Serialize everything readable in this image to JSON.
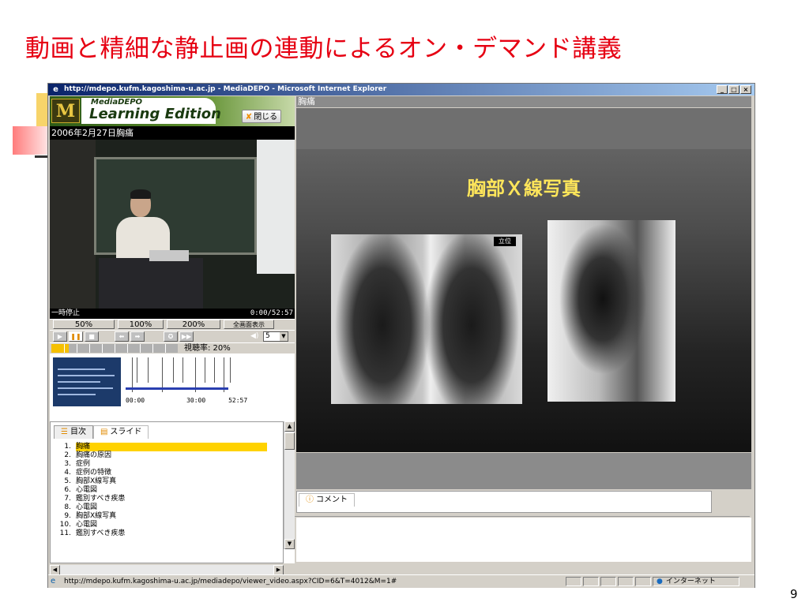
{
  "slide": {
    "title": "動画と精細な静止画の連動によるオン・デマンド講義",
    "page_number": "9"
  },
  "window": {
    "title": "http://mdepo.kufm.kagoshima-u.ac.jp - MediaDEPO - Microsoft Internet Explorer",
    "buttons": {
      "minimize": "_",
      "maximize": "□",
      "close": "×"
    }
  },
  "app": {
    "logo_small": "MediaDEPO",
    "logo_big": "Learning Edition",
    "logo_letter": "M",
    "close_button": "閉じる",
    "lecture_title": "2006年2月27日胸痛"
  },
  "player": {
    "status": "一時停止",
    "time": "0:00/52:57",
    "zoom_buttons": [
      "50%",
      "100%",
      "200%",
      "全画面表示"
    ],
    "volume_value": "5",
    "view_rate": "視聴率: 20%",
    "progress_fraction": 0.14,
    "timeline_labels": [
      "00:00",
      "30:00",
      "52:57"
    ]
  },
  "toc": {
    "tabs": [
      "目次",
      "スライド"
    ],
    "items": [
      {
        "num": "1.",
        "label": "胸痛"
      },
      {
        "num": "2.",
        "label": "胸痛の原因"
      },
      {
        "num": "3.",
        "label": "症例"
      },
      {
        "num": "4.",
        "label": "症例の特徴"
      },
      {
        "num": "5.",
        "label": "胸部X線写真"
      },
      {
        "num": "6.",
        "label": "心電図"
      },
      {
        "num": "7.",
        "label": "鑑別すべき疾患"
      },
      {
        "num": "8.",
        "label": "心電図"
      },
      {
        "num": "9.",
        "label": "胸部X線写真"
      },
      {
        "num": "10.",
        "label": "心電図"
      },
      {
        "num": "11.",
        "label": "鑑別すべき疾患"
      }
    ]
  },
  "slide_view": {
    "label": "胸痛",
    "heading": "胸部Ｘ線写真",
    "xray_tag": "立位"
  },
  "comment": {
    "tab_label": "コメント"
  },
  "statusbar": {
    "url": "http://mdepo.kufm.kagoshima-u.ac.jp/mediadepo/viewer_video.aspx?CID=6&T=4012&M=1#",
    "zone": "インターネット"
  },
  "colors": {
    "title_red": "#e60012",
    "highlight": "#ffd200",
    "slide_heading": "#ffe65a"
  }
}
